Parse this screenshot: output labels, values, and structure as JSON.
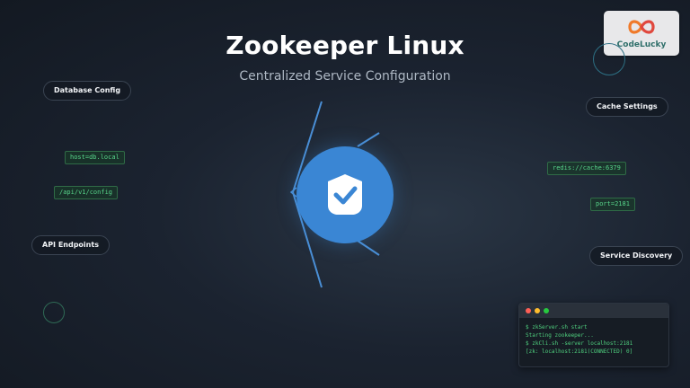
{
  "header": {
    "title": "Zookeeper Linux",
    "subtitle": "Centralized Service Configuration"
  },
  "logo": {
    "text": "CodeLucky",
    "icon": "infinity-logo-icon"
  },
  "labels": {
    "database_config": "Database Config",
    "api_endpoints": "API Endpoints",
    "cache_settings": "Cache Settings",
    "service_discovery": "Service Discovery"
  },
  "code_tags": {
    "host": "host=db.local",
    "api_path": "/api/v1/config",
    "redis": "redis://cache:6379",
    "port": "port=2181"
  },
  "hub": {
    "icon": "shield-check-icon"
  },
  "terminal": {
    "lines": [
      "$ zkServer.sh start",
      "Starting zookeeper...",
      "$ zkCli.sh -server localhost:2181",
      "[zk: localhost:2181(CONNECTED) 0]"
    ]
  },
  "colors": {
    "accent_blue": "#3a86d4",
    "code_green": "#57d48a",
    "terminal_red": "#ff5f56",
    "terminal_yellow": "#ffbd2e",
    "terminal_green": "#27c93f"
  }
}
